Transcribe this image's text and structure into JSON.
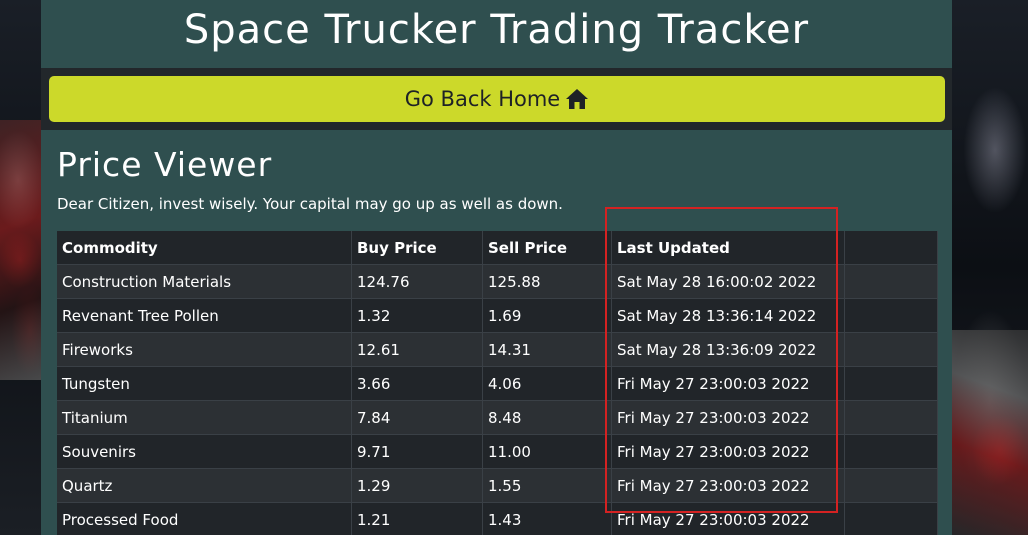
{
  "app": {
    "title": "Space Trucker Trading Tracker"
  },
  "nav": {
    "home_label": "Go Back Home",
    "home_icon": "home-icon"
  },
  "page": {
    "heading": "Price Viewer",
    "subtitle": "Dear Citizen, invest wisely. Your capital may go up as well as down."
  },
  "table": {
    "columns": [
      "Commodity",
      "Buy Price",
      "Sell Price",
      "Last Updated"
    ],
    "rows": [
      [
        "Construction Materials",
        "124.76",
        "125.88",
        "Sat May 28 16:00:02 2022"
      ],
      [
        "Revenant Tree Pollen",
        "1.32",
        "1.69",
        "Sat May 28 13:36:14 2022"
      ],
      [
        "Fireworks",
        "12.61",
        "14.31",
        "Sat May 28 13:36:09 2022"
      ],
      [
        "Tungsten",
        "3.66",
        "4.06",
        "Fri May 27 23:00:03 2022"
      ],
      [
        "Titanium",
        "7.84",
        "8.48",
        "Fri May 27 23:00:03 2022"
      ],
      [
        "Souvenirs",
        "9.71",
        "11.00",
        "Fri May 27 23:00:03 2022"
      ],
      [
        "Quartz",
        "1.29",
        "1.55",
        "Fri May 27 23:00:03 2022"
      ],
      [
        "Processed Food",
        "1.21",
        "1.43",
        "Fri May 27 23:00:03 2022"
      ]
    ]
  },
  "colors": {
    "panel": "#2f4f4f",
    "button": "#ccd92a",
    "table_dark": "#212529",
    "table_light": "#2c3034",
    "highlight": "#d42222"
  }
}
